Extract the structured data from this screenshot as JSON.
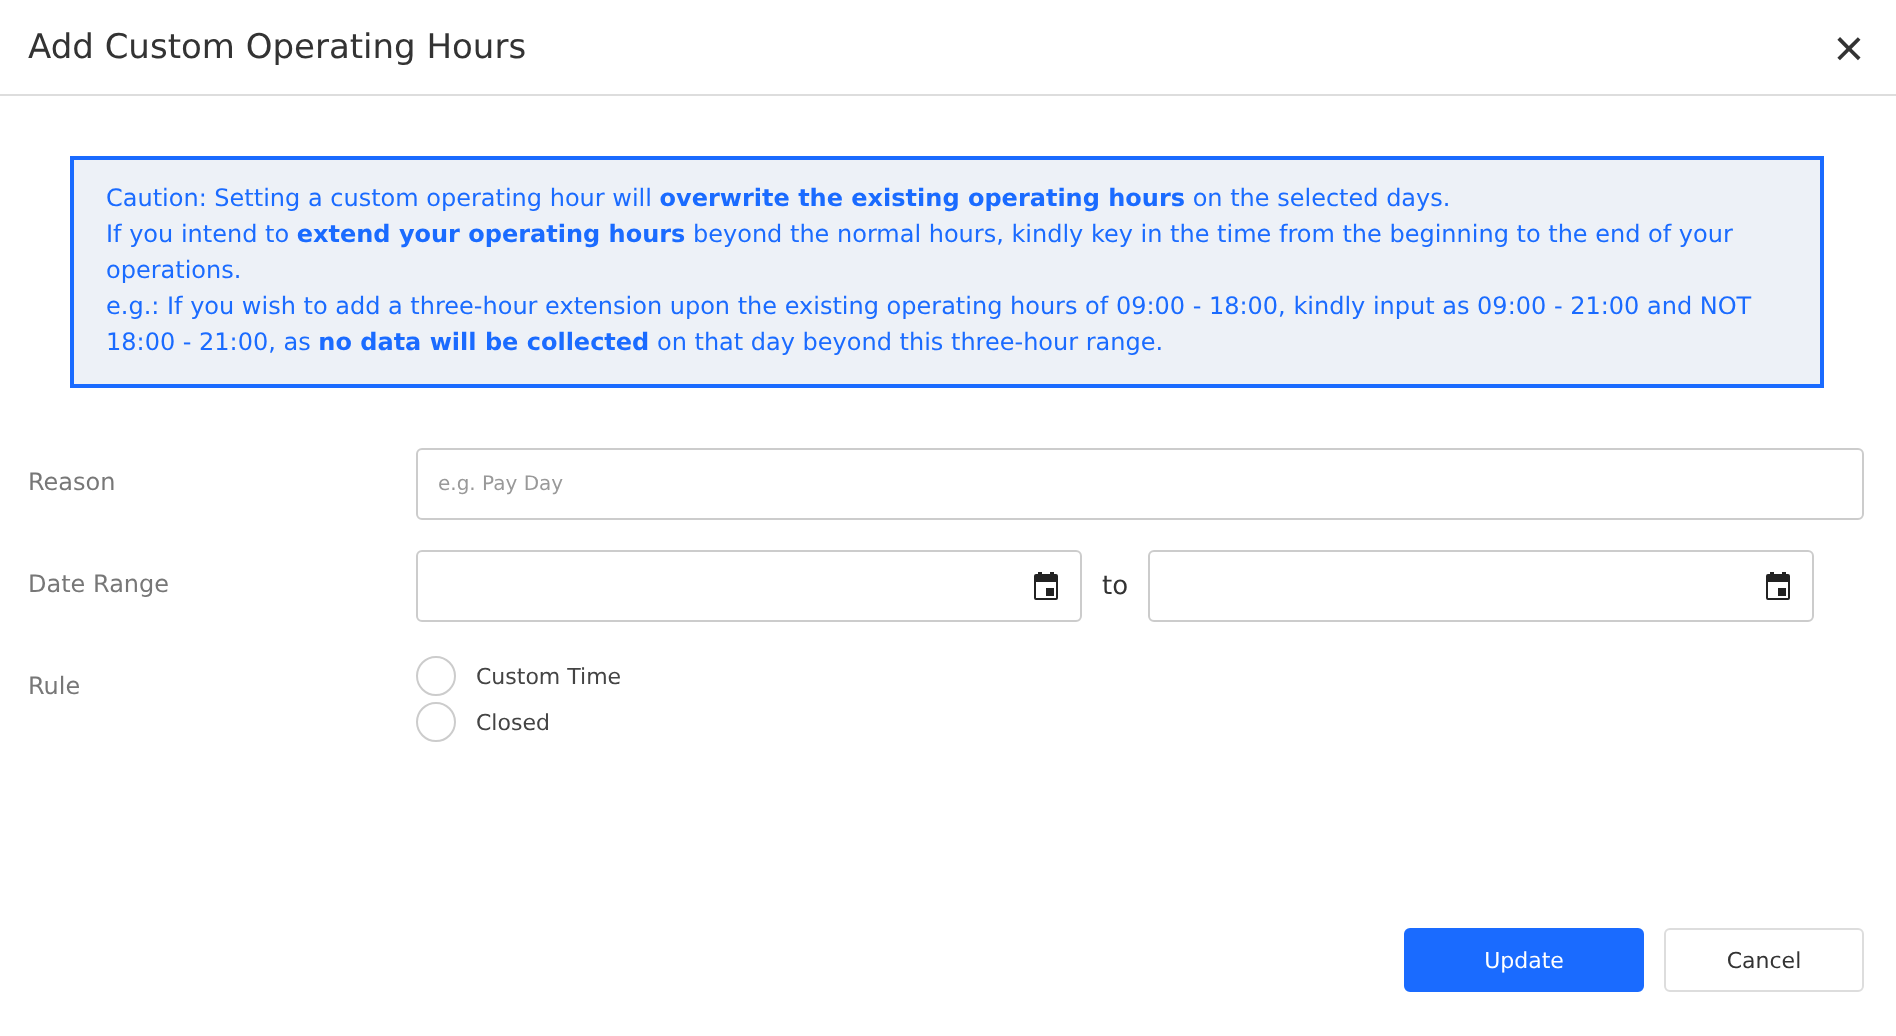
{
  "dialog": {
    "title": "Add Custom Operating Hours",
    "close": "×"
  },
  "notice": [
    "Caution: Setting a custom operating hour will **overwrite the existing operating hours** on the selected days.",
    "If you intend to **extend your operating hours** beyond the normal hours, kindly key in the time from the beginning to the end of your operations.",
    "e.g.: If you wish to add a three-hour extension upon the existing operating hours of 09:00 - 18:00, kindly input as 09:00 - 21:00 and NOT 18:00 - 21:00, as **no data will be collected** on that day beyond this three-hour range."
  ],
  "reason": {
    "label": "Reason",
    "placeholder": "e.g. Pay Day"
  },
  "date_range": {
    "label": "Date Range",
    "separator": "to"
  },
  "rule": {
    "label": "Rule",
    "options": [
      {
        "label": "Custom Time",
        "selected": false
      },
      {
        "label": "Closed",
        "selected": false
      }
    ]
  },
  "buttons": [
    {
      "label": "Update",
      "kind": "primary"
    },
    {
      "label": "Cancel",
      "kind": "secondary"
    }
  ]
}
